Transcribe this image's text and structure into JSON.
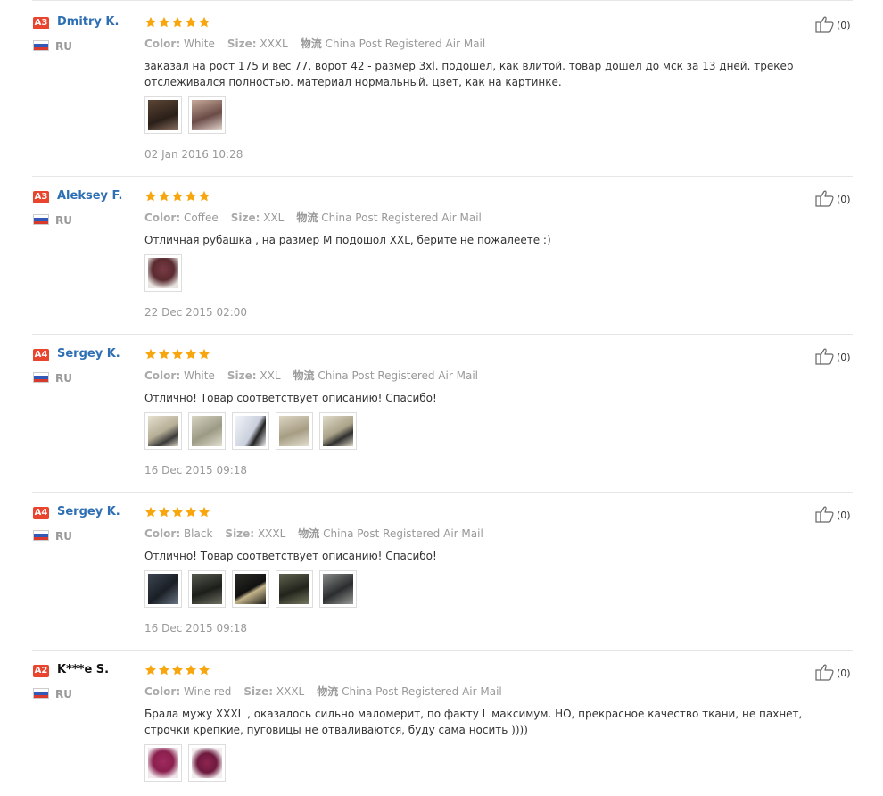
{
  "labels": {
    "color": "Color:",
    "size": "Size:",
    "shipping_icon": "物流"
  },
  "colors": {
    "star": "#f8a60e",
    "name": "#2e6fb4",
    "badge_a3": "#e8442e",
    "badge_a4": "#e8442e",
    "badge_a2": "#e8442e"
  },
  "reviews": [
    {
      "badge": "A3",
      "name": "Dmitry K.",
      "country": "RU",
      "rating": 5,
      "color": "White",
      "size": "XXXL",
      "shipping": "China Post Registered Air Mail",
      "text": "заказал на рост 175 и вес 77, ворот 42 - размер 3xl. подошел, как влитой. товар дошел до мск за 13 дней. трекер отслеживался полностью. материал нормальный. цвет, как на картинке.",
      "photos": [
        "dark-garment-photo",
        "garment-on-bed-photo"
      ],
      "date": "02 Jan 2016 10:28",
      "helpful": "(0)"
    },
    {
      "badge": "A3",
      "name": "Aleksey F.",
      "country": "RU",
      "rating": 5,
      "color": "Coffee",
      "size": "XXL",
      "shipping": "China Post Registered Air Mail",
      "text": "Отличная рубашка , на размер М подошол XXL, берите не пожалеете :)",
      "photos": [
        "person-wearing-shirt-photo"
      ],
      "date": "22 Dec 2015 02:00",
      "helpful": "(0)"
    },
    {
      "badge": "A4",
      "name": "Sergey K.",
      "country": "RU",
      "rating": 5,
      "color": "White",
      "size": "XXL",
      "shipping": "China Post Registered Air Mail",
      "text": "Отлично! Товар соответствует описанию! Спасибо!",
      "photos": [
        "white-shirt-photo-1",
        "white-shirt-photo-2",
        "white-shirt-photo-3",
        "white-shirt-photo-4",
        "white-shirt-photo-5"
      ],
      "date": "16 Dec 2015 09:18",
      "helpful": "(0)"
    },
    {
      "badge": "A4",
      "name": "Sergey K.",
      "country": "RU",
      "rating": 5,
      "color": "Black",
      "size": "XXXL",
      "shipping": "China Post Registered Air Mail",
      "text": "Отлично! Товар соответствует описанию! Спасибо!",
      "photos": [
        "black-shirt-photo-1",
        "black-shirt-photo-2",
        "black-shirt-photo-3",
        "black-shirt-photo-4",
        "black-shirt-photo-5"
      ],
      "date": "16 Dec 2015 09:18",
      "helpful": "(0)"
    },
    {
      "badge": "A2",
      "name": "K***e S.",
      "country": "RU",
      "rating": 5,
      "color": "Wine red",
      "size": "XXXL",
      "shipping": "China Post Registered Air Mail",
      "text": "Брала мужу XXXL , оказалось сильно маломерит, по факту L максимум. НО, прекрасное качество ткани, не пахнет, строчки крепкие, пуговицы не отваливаются, буду сама носить ))))",
      "photos": [
        "wine-shirt-photo-1",
        "wine-shirt-photo-2"
      ],
      "date": "",
      "helpful": "(0)"
    }
  ]
}
